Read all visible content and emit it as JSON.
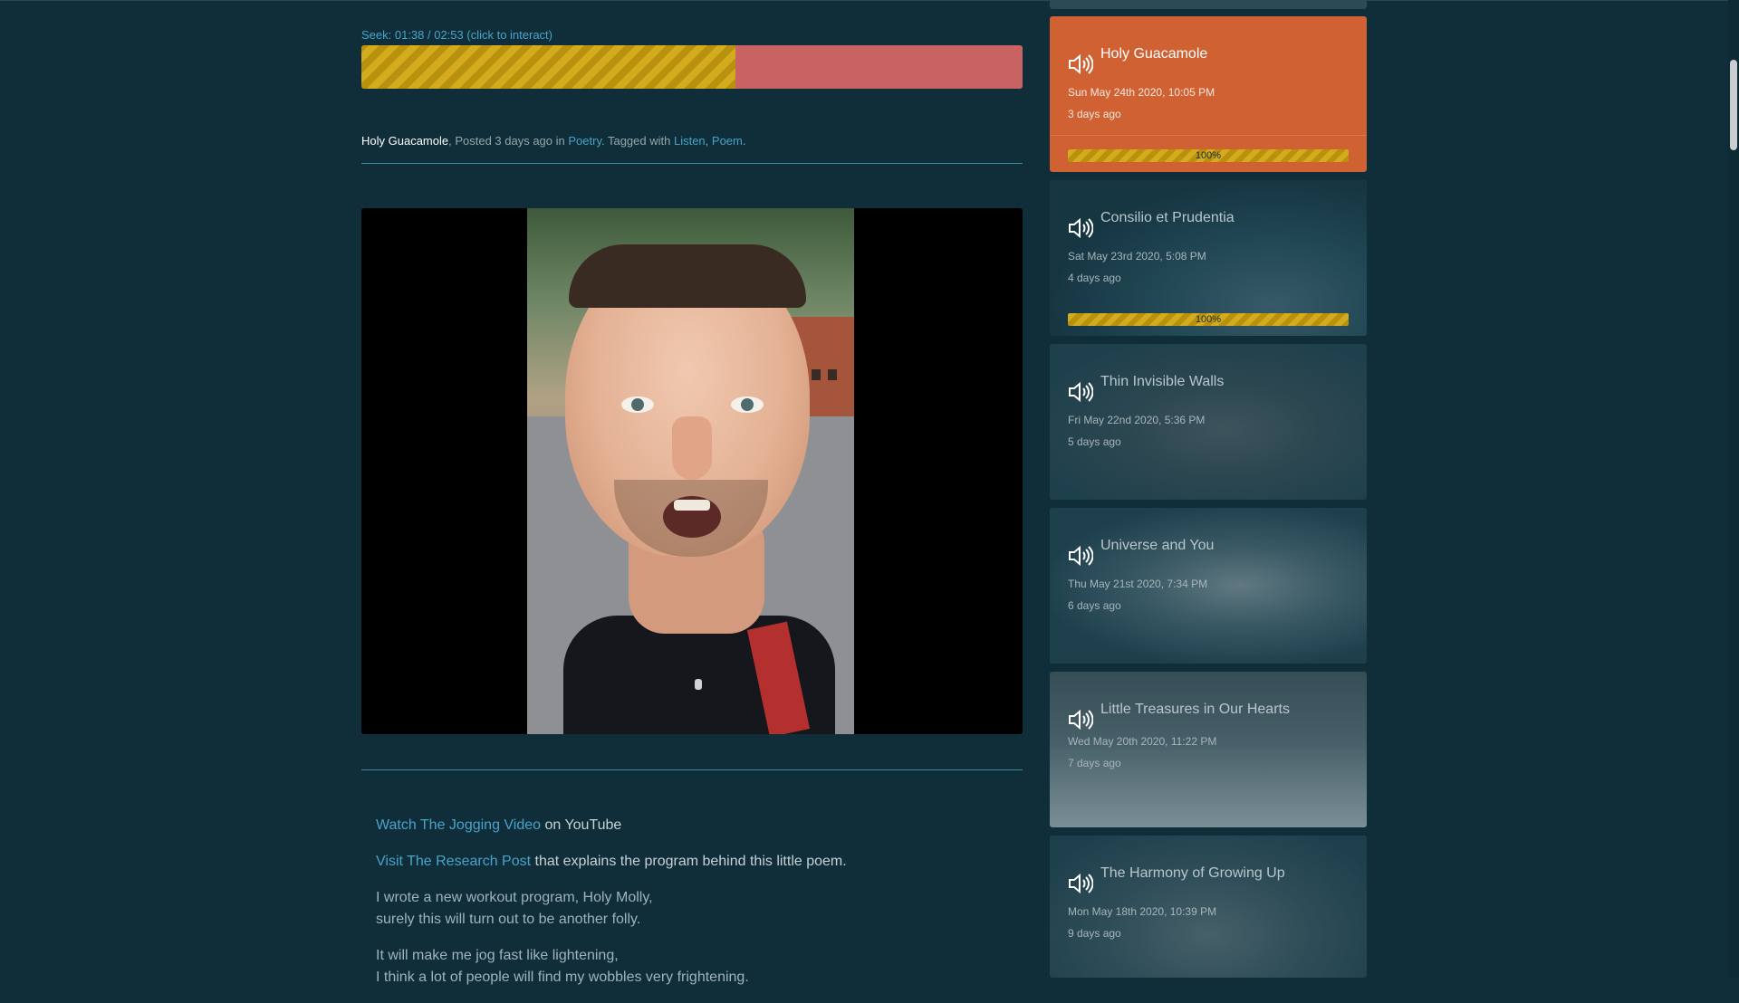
{
  "player": {
    "seek_label": "Seek: 01:38 / 02:53 (click to interact)",
    "progress_fraction": 0.566
  },
  "post_meta": {
    "title": "Holy Guacamole",
    "posted_text": ", Posted 3 days ago in ",
    "category": "Poetry",
    "tagged_text": ". Tagged with ",
    "tag1": "Listen",
    "comma": ", ",
    "tag2": "Poem",
    "end": "."
  },
  "body": {
    "link1": "Watch The Jogging Video",
    "link1_suffix": " on YouTube",
    "link2": "Visit The Research Post",
    "link2_suffix": " that explains the program behind this little poem.",
    "poem_line1": "I wrote a new workout program, Holy Molly,",
    "poem_line2": "surely this will turn out to be another folly.",
    "poem_line3": "It will make me jog fast like lightening,",
    "poem_line4": "I think a lot of people will find my wobbles very frightening."
  },
  "sidebar": {
    "items": [
      {
        "title": "Holy Guacamole",
        "date": "Sun May 24th 2020, 10:05 PM",
        "ago": "3 days ago",
        "progress": "100%",
        "progress_value": 1.0
      },
      {
        "title": "Consilio et Prudentia",
        "date": "Sat May 23rd 2020, 5:08 PM",
        "ago": "4 days ago",
        "progress": "100%",
        "progress_value": 1.0
      },
      {
        "title": "Thin Invisible Walls",
        "date": "Fri May 22nd 2020, 5:36 PM",
        "ago": "5 days ago"
      },
      {
        "title": "Universe and You",
        "date": "Thu May 21st 2020, 7:34 PM",
        "ago": "6 days ago"
      },
      {
        "title": "Little Treasures in Our Hearts",
        "date": "Wed May 20th 2020, 11:22 PM",
        "ago": "7 days ago"
      },
      {
        "title": "The Harmony of Growing Up",
        "date": "Mon May 18th 2020, 10:39 PM",
        "ago": "9 days ago"
      }
    ],
    "icon": "speaker-icon"
  },
  "colors": {
    "background": "#0f2e3a",
    "accent_link": "#49a3c8",
    "active_card": "#d06132",
    "seek_remaining": "#c96262",
    "progress_stripe": "#d3ab1c"
  }
}
